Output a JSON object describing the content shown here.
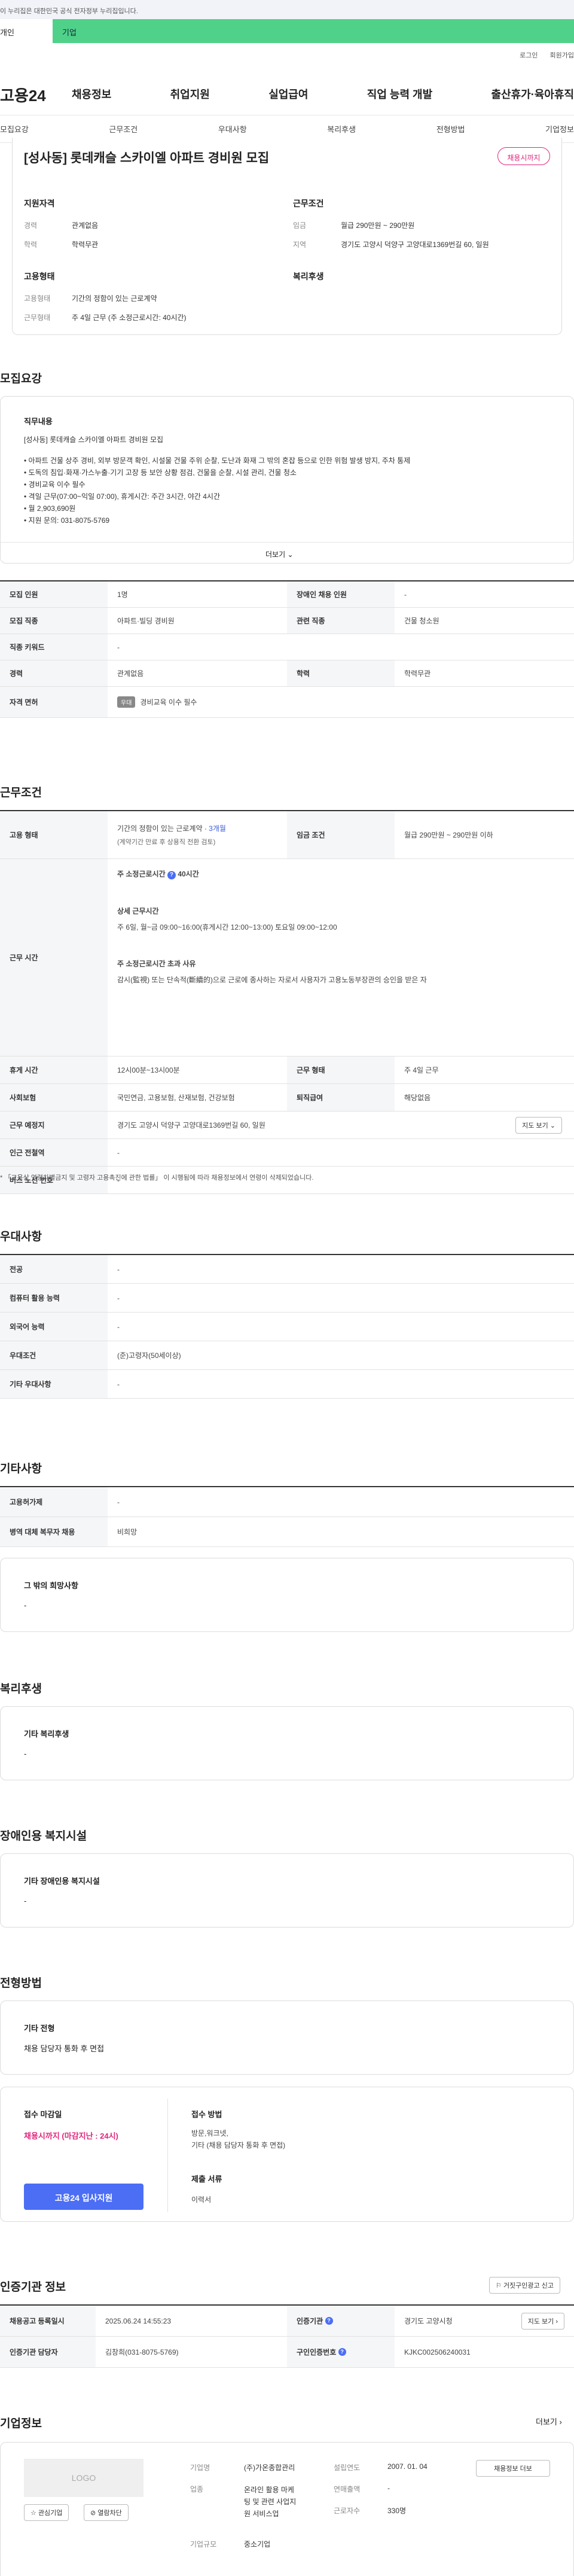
{
  "banner": {
    "text": "이 누리집은 대한민국 공식 전자정부 누리집입니다."
  },
  "topTabs": {
    "individual": "개인",
    "company": "기업"
  },
  "util": {
    "login": "로그인",
    "signup": "회원가입"
  },
  "logo": "고용24",
  "gnb": [
    "채용정보",
    "취업지원",
    "실업급여",
    "직업 능력 개발",
    "출산휴가·육아휴직"
  ],
  "subnav": [
    "모집요강",
    "근무조건",
    "우대사항",
    "복리후생",
    "전형방법",
    "기업정보"
  ],
  "summary": {
    "title": "[성사동] 롯데캐슬 스카이엘 아파트 경비원 모집",
    "badge": "채용시까지",
    "qual_h": "지원자격",
    "career_k": "경력",
    "career_v": "관계없음",
    "edu_k": "학력",
    "edu_v": "학력무관",
    "type_h": "고용형태",
    "emp_k": "고용형태",
    "emp_v": "기간의 정함이 있는 근로계약",
    "work_k": "근무형태",
    "work_v": "주 4일 근무 (주 소정근로시간: 40시간)",
    "cond_h": "근무조건",
    "wage_k": "임금",
    "wage_v": "월급 290만원 ~ 290만원",
    "region_k": "지역",
    "region_v": "경기도 고양시 덕양구 고양대로1369번길 60, 일원",
    "welfare_h": "복리후생"
  },
  "recruit": {
    "heading": "모집요강",
    "duty_h": "직무내용",
    "duty_title": "[성사동] 롯데캐슬 스카이엘 아파트 경비원 모집",
    "lines": [
      "• 아파트 건물 상주 경비, 외부 방문객 확인, 시설물 건물 주위 순찰, 도난과 화재 그 밖의 혼잡 등으로 인한 위험 발생 방지, 주차 통제",
      "• 도독의 침입·화재·가스누출·기기 고장 등 보안 상황 점검,   건물을 순찰, 시설 관리, 건물 청소",
      "• 경비교육 이수 필수",
      "• 격일 근무(07:00~익일 07:00), 휴게시간: 주간 3시간, 야간 4시간",
      "• 월 2,903,690원",
      "• 지원 문의: 031-8075-5769"
    ],
    "more": "더보기",
    "rows": [
      {
        "k1": "모집 인원",
        "v1": "1명",
        "k2": "장애인 채용 인원",
        "v2": "-"
      },
      {
        "k1": "모집 직종",
        "v1": "아파트·빌딩 경비원",
        "k2": "관련 직종",
        "v2": "건물 청소원"
      },
      {
        "k1": "직종 키워드",
        "v1": "-"
      },
      {
        "k1": "경력",
        "v1": "관계없음",
        "k2": "학력",
        "v2": "학력무관"
      }
    ],
    "license_k": "자격 면허",
    "license_chip": "우대",
    "license_v": "경비교육 이수 필수"
  },
  "work": {
    "heading": "근무조건",
    "emp_k": "고용 형태",
    "emp_v": "기간의 정함이 있는 근로계약 · ",
    "emp_link": "3개월",
    "emp_sub": "(계약기간 만료 후 상용직 전환 검토)",
    "wage_k": "임금 조건",
    "wage_v": "월급 290만원 ~ 290만원 이하",
    "time_k": "근무 시간",
    "time_h1": "주 소정근로시간",
    "time_h1b": "40시간",
    "time_h2": "상세 근무시간",
    "time_v2": "주 6일, 월~금 09:00~16:00(휴게시간 12:00~13:00)  토요일 09:00~12:00",
    "time_h3": "주 소정근로시간 초과 사유",
    "time_v3": "감시(監視) 또는 단속적(斷續的)으로 근로에 종사하는 자로서 사용자가 고용노동부장관의 승인을 받은 자",
    "rest_k": "휴게 시간",
    "rest_v": "12시00분~13시00분",
    "shift_k": "근무 형태",
    "shift_v": "주 4일 근무",
    "ins_k": "사회보험",
    "ins_v": "국민연금, 고용보험, 산재보험, 건강보험",
    "sev_k": "퇴직급여",
    "sev_v": "해당없음",
    "place_k": "근무 예정지",
    "place_v": "경기도 고양시 덕양구 고양대로1369번길 60, 일원",
    "map": "지도 보기",
    "sub_k": "인근 전철역",
    "sub_v": "-",
    "bus_k": "버스 노선 번호",
    "bus_v": "-",
    "note": "* 「고용상 연령차별금지 및 고령자 고용촉진에 관한 법률」 이 시행됨에 따라 채용정보에서 연령이 삭제되었습니다."
  },
  "pref": {
    "heading": "우대사항",
    "rows": [
      {
        "k": "전공",
        "v": "-"
      },
      {
        "k": "컴퓨터 활용 능력",
        "v": "-"
      },
      {
        "k": "외국어 능력",
        "v": "-"
      },
      {
        "k": "우대조건",
        "v": "(준)고령자(50세이상)"
      },
      {
        "k": "기타 우대사항",
        "v": "-"
      }
    ]
  },
  "etc": {
    "heading": "기타사항",
    "rows": [
      {
        "k": "고용허가제",
        "v": "-"
      },
      {
        "k": "병역 대체 복무자 채용",
        "v": "비희망"
      }
    ],
    "other_h": "그 밖의 희망사항",
    "other_v": "-"
  },
  "welfare": {
    "heading": "복리후생",
    "h": "기타 복리후생",
    "v": "-"
  },
  "disabled": {
    "heading": "장애인용 복지시설",
    "h": "기타 장애인용 복지시설",
    "v": "-"
  },
  "screening": {
    "heading": "전형방법",
    "h": "기타 전형",
    "v": "채용 담당자 통화 후 면접",
    "deadline_h": "접수 마감일",
    "deadline_v": "채용시까지 (마감지난 : 24시)",
    "method_h": "접수 방법",
    "method_v1": "방문,워크넷,",
    "method_v2": "기타 (채용 담당자 통화 후 면접)",
    "docs_h": "제출 서류",
    "docs_v": "이력서",
    "apply": "고용24 입사지원"
  },
  "agency": {
    "heading": "인증기관 정보",
    "report": "거짓구인광고 신고",
    "r1k1": "채용공고 등록일시",
    "r1v1": "2025.06.24 14:55:23",
    "r1k2": "인증기관",
    "r1v2": "경기도 고양시청",
    "map": "지도 보기",
    "r2k1": "인증기관 담당자",
    "r2v1": "김창희(031-8075-5769)",
    "r2k2": "구인인증번호",
    "r2v2": "KJKC002506240031"
  },
  "company": {
    "heading": "기업정보",
    "more": "더보기",
    "logo": "LOGO",
    "fav": "관심기업",
    "hide": "열람차단",
    "name_k": "기업명",
    "name_v": "(주)가온종합관리",
    "biz_k": "업종",
    "biz_v1": "온라인 활용 마케",
    "biz_v2": "팅 및 관련 사업지",
    "biz_v3": "원 서비스업",
    "size_k": "기업규모",
    "size_v": "중소기업",
    "est_k": "설립연도",
    "est_v": "2007. 01. 04",
    "sales_k": "연매출액",
    "sales_v": "-",
    "emp_k": "근로자수",
    "emp_v": "330명",
    "jobs_btn": "채용정보 더보"
  }
}
